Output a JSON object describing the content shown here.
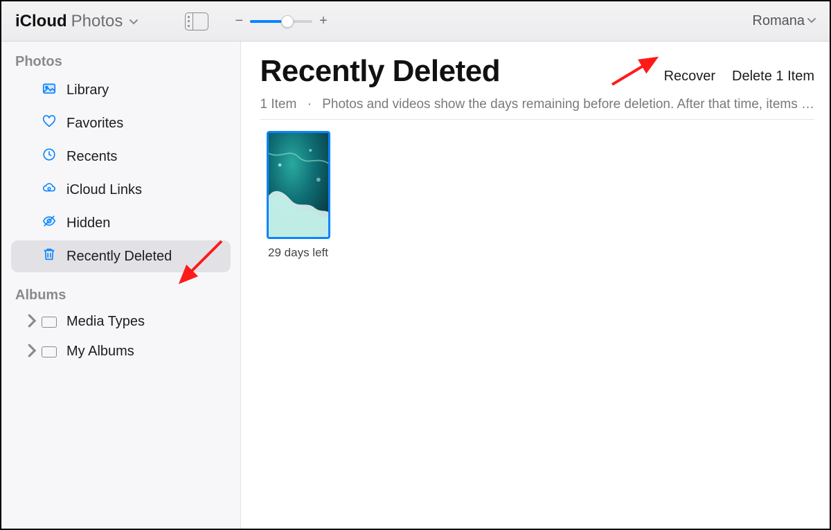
{
  "brand": {
    "primary": "iCloud",
    "secondary": "Photos"
  },
  "user": {
    "name": "Romana"
  },
  "sidebar": {
    "sections": {
      "photos_header": "Photos",
      "albums_header": "Albums"
    },
    "items": [
      {
        "label": "Library"
      },
      {
        "label": "Favorites"
      },
      {
        "label": "Recents"
      },
      {
        "label": "iCloud Links"
      },
      {
        "label": "Hidden"
      },
      {
        "label": "Recently Deleted"
      }
    ],
    "collections": [
      {
        "label": "Media Types"
      },
      {
        "label": "My Albums"
      }
    ]
  },
  "main": {
    "title": "Recently Deleted",
    "actions": {
      "recover": "Recover",
      "delete": "Delete 1 Item"
    },
    "meta": {
      "count": "1 Item",
      "hint": "Photos and videos show the days remaining before deletion. After that time, items …"
    },
    "items": [
      {
        "caption": "29 days left"
      }
    ]
  }
}
